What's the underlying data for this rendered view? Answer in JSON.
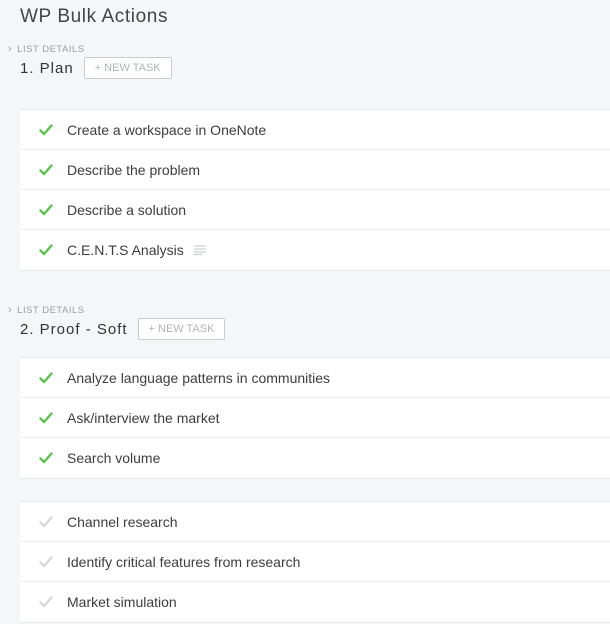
{
  "page": {
    "title": "WP Bulk Actions"
  },
  "colors": {
    "check_done": "#5ac34a",
    "check_open": "#d6d8db"
  },
  "lists": [
    {
      "details_label": "LIST DETAILS",
      "name": "1. Plan",
      "new_task_label": "+ NEW TASK",
      "tasks": [
        {
          "name": "Create a workspace in OneNote",
          "done": true,
          "icon": "check-icon"
        },
        {
          "name": "Describe the problem",
          "done": true,
          "icon": "check-icon"
        },
        {
          "name": "Describe a solution",
          "done": true,
          "icon": "check-icon"
        },
        {
          "name": "C.E.N.T.S Analysis",
          "done": true,
          "icon": "check-icon",
          "extra_icon": "description-icon"
        }
      ]
    },
    {
      "details_label": "LIST DETAILS",
      "name": "2. Proof - Soft",
      "new_task_label": "+ NEW TASK",
      "tasks": [
        {
          "name": "Analyze language patterns in communities",
          "done": true,
          "icon": "check-icon"
        },
        {
          "name": "Ask/interview the market",
          "done": true,
          "icon": "check-icon"
        },
        {
          "name": "Search volume",
          "done": true,
          "icon": "check-icon"
        }
      ],
      "open_tasks": [
        {
          "name": "Channel research",
          "done": false,
          "icon": "check-icon"
        },
        {
          "name": "Identify critical features from research",
          "done": false,
          "icon": "check-icon"
        },
        {
          "name": "Market simulation",
          "done": false,
          "icon": "check-icon"
        }
      ]
    }
  ]
}
